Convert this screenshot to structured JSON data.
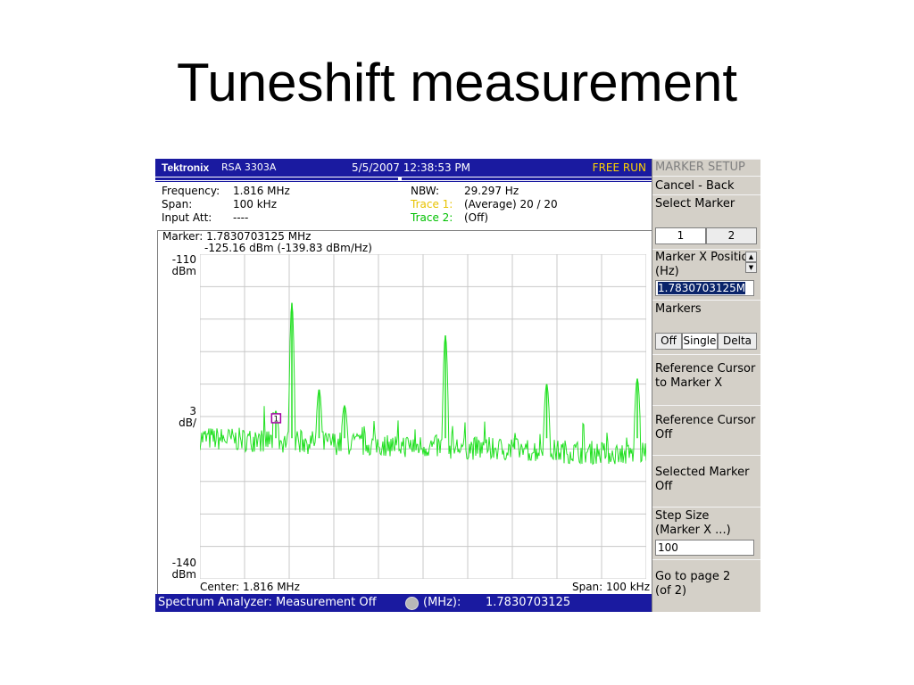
{
  "slide": {
    "title": "Tuneshift measurement"
  },
  "header": {
    "brand": "Tektronix",
    "model": "RSA 3303A",
    "datetime": "5/5/2007 12:38:53 PM",
    "run_state": "FREE RUN"
  },
  "settings": {
    "frequency_label": "Frequency:",
    "frequency": "1.816 MHz",
    "span_label": "Span:",
    "span": "100 kHz",
    "input_att_label": "Input Att:",
    "input_att": "----",
    "nbw_label": "NBW:",
    "nbw": "29.297 Hz",
    "trace1_label": "Trace 1:",
    "trace1": "(Average)  20 / 20",
    "trace2_label": "Trace 2:",
    "trace2": "(Off)"
  },
  "marker_readout": {
    "line1": "Marker: 1.7830703125 MHz",
    "line2": "-125.16 dBm (-139.83 dBm/Hz)"
  },
  "axis": {
    "top_value": "-110",
    "top_unit": "dBm",
    "scale_value": "3",
    "scale_unit": "dB/",
    "bottom_value": "-140",
    "bottom_unit": "dBm",
    "center": "Center: 1.816 MHz",
    "span": "Span: 100 kHz"
  },
  "status": {
    "mode": "Spectrum Analyzer: Measurement Off",
    "unit": "(MHz):",
    "value": "1.7830703125"
  },
  "menu": {
    "title": "MARKER SETUP",
    "cancel_back": "Cancel - Back",
    "select_marker": "Select Marker",
    "marker_1": "1",
    "marker_2": "2",
    "marker_x_position_line1": "Marker X Positio",
    "marker_x_position_line2": "(Hz)",
    "marker_x_value": "1.7830703125M",
    "markers": "Markers",
    "markers_off": "Off",
    "markers_single": "Single",
    "markers_delta": "Delta",
    "ref_cursor_to_marker_line1": "Reference Cursor",
    "ref_cursor_to_marker_line2": "to Marker X",
    "ref_cursor_off_line1": "Reference Cursor",
    "ref_cursor_off_line2": "Off",
    "selected_marker_off_line1": "Selected Marker",
    "selected_marker_off_line2": "Off",
    "step_size_line1": "Step Size",
    "step_size_line2": "(Marker X ...)",
    "step_size_value": "100",
    "go_to_page_line1": "Go to page 2",
    "go_to_page_line2": "(of 2)"
  },
  "colors": {
    "trace": "#22e022",
    "grid": "#c8c8c8",
    "header_bg": "#1a1aa0",
    "marker": "#a000a0"
  },
  "chart_data": {
    "type": "line",
    "x_unit": "MHz",
    "y_unit": "dBm",
    "xlim": [
      1.766,
      1.866
    ],
    "ylim": [
      -140,
      -110
    ],
    "grid": true,
    "noise_floor": -127,
    "peaks": [
      {
        "x": 1.783,
        "y": -124.5
      },
      {
        "x": 1.7866,
        "y": -114.5
      },
      {
        "x": 1.7927,
        "y": -122.5
      },
      {
        "x": 1.7984,
        "y": -124.0
      },
      {
        "x": 1.821,
        "y": -117.5
      },
      {
        "x": 1.8365,
        "y": -128.0
      },
      {
        "x": 1.8437,
        "y": -122.0
      },
      {
        "x": 1.864,
        "y": -121.5
      }
    ],
    "marker": {
      "x": 1.7830703125,
      "y": -125.16
    }
  }
}
